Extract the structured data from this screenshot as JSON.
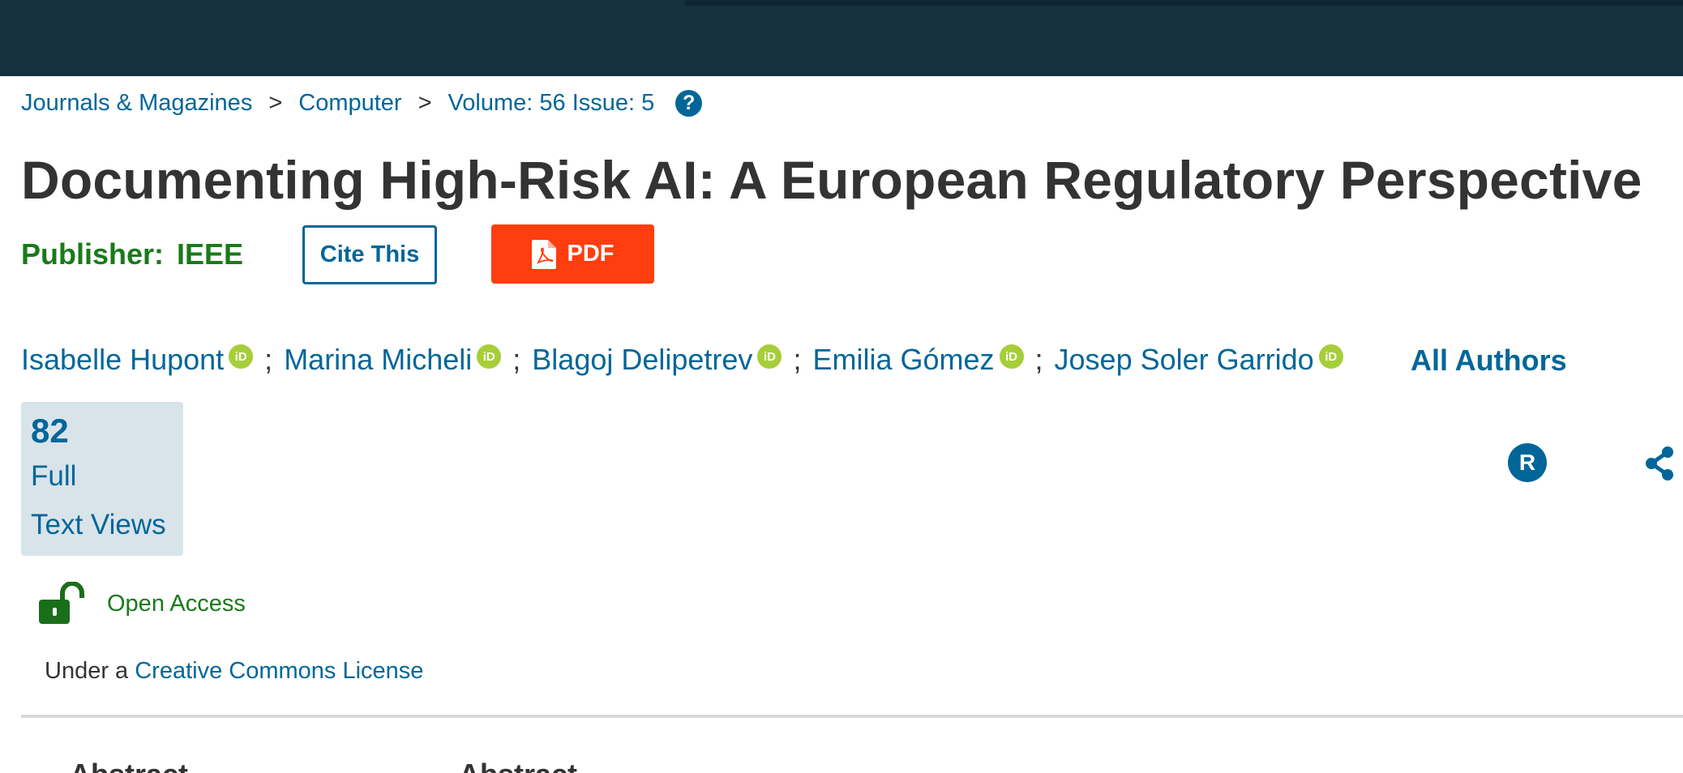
{
  "breadcrumb": {
    "items": [
      "Journals & Magazines",
      "Computer",
      "Volume: 56 Issue: 5"
    ],
    "separator": ">",
    "help_icon": "question-circle-icon"
  },
  "article": {
    "title": "Documenting High-Risk AI: A European Regulatory Perspective",
    "publisher_label": "Publisher:",
    "publisher_name": "IEEE",
    "cite_label": "Cite This",
    "pdf_label": "PDF"
  },
  "authors": {
    "list": [
      "Isabelle Hupont",
      "Marina Micheli",
      "Blagoj Delipetrev",
      "Emilia Gómez",
      "Josep Soler Garrido"
    ],
    "separator": ";",
    "orcid_badge": "iD",
    "all_authors_label": "All Authors"
  },
  "metrics": {
    "count": "82",
    "label_line1": "Full",
    "label_line2": "Text Views"
  },
  "actions": {
    "r_label": "R",
    "share_icon": "share-icon"
  },
  "access": {
    "status": "Open Access",
    "license_prefix": "Under a",
    "license_link": "Creative Commons License"
  },
  "tabs": {
    "left": "Abstract",
    "right": "Abstract"
  },
  "colors": {
    "topbar": "#16303f",
    "link": "#006699",
    "publisher": "#1a7a1a",
    "pdf_button": "#ff3d0f",
    "orcid": "#a6ce39",
    "metrics_bg": "#d9e4ea"
  }
}
